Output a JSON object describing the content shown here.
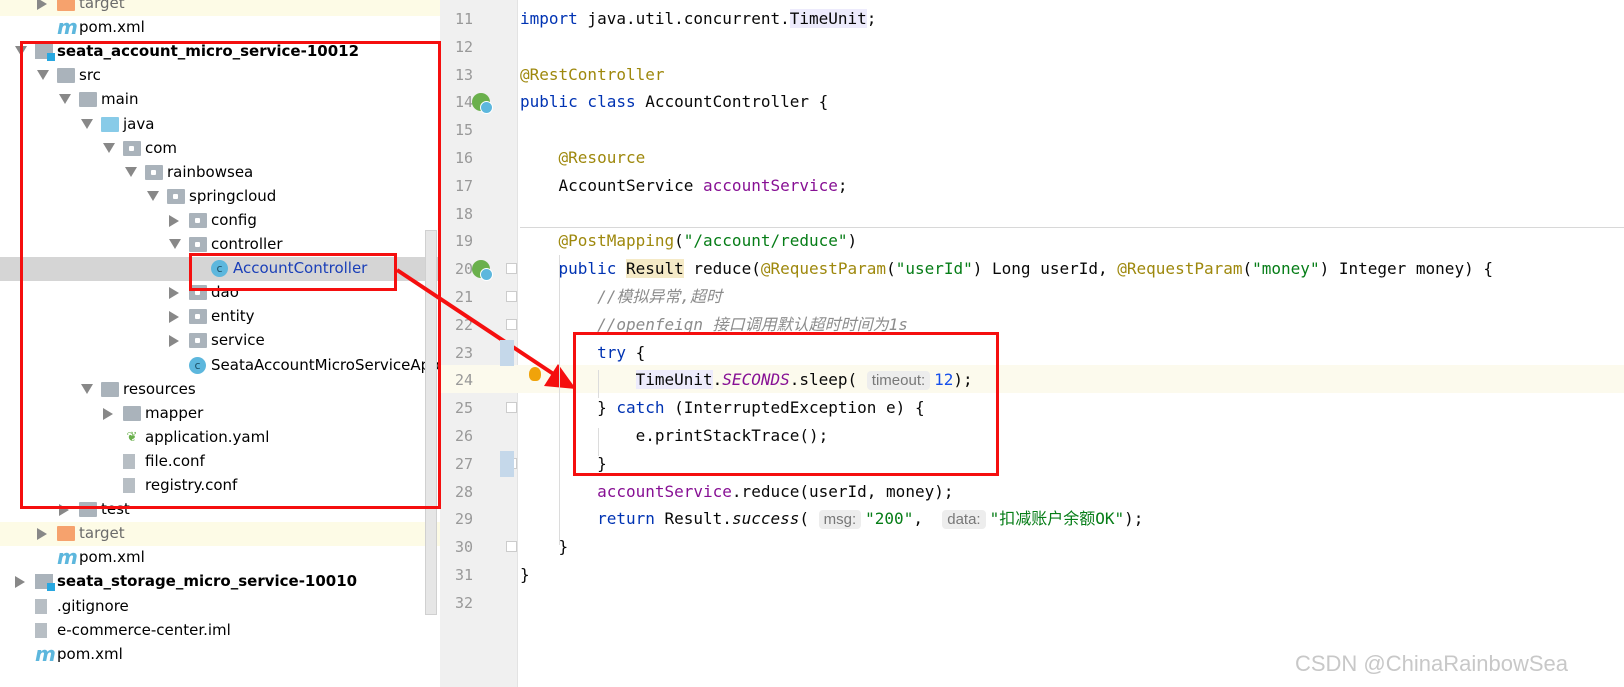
{
  "project_tree": [
    {
      "label": "target",
      "level": 1,
      "arrow": "closed",
      "icon": "folder-target",
      "style": "orange",
      "excluded": true
    },
    {
      "label": "pom.xml",
      "level": 1,
      "arrow": "none",
      "icon": "maven"
    },
    {
      "label": "seata_account_micro_service-10012",
      "level": 0,
      "arrow": "open",
      "icon": "module",
      "style": "bold"
    },
    {
      "label": "src",
      "level": 1,
      "arrow": "open",
      "icon": "folder"
    },
    {
      "label": "main",
      "level": 2,
      "arrow": "open",
      "icon": "folder"
    },
    {
      "label": "java",
      "level": 3,
      "arrow": "open",
      "icon": "folder-src"
    },
    {
      "label": "com",
      "level": 4,
      "arrow": "open",
      "icon": "package"
    },
    {
      "label": "rainbowsea",
      "level": 5,
      "arrow": "open",
      "icon": "package"
    },
    {
      "label": "springcloud",
      "level": 6,
      "arrow": "open",
      "icon": "package"
    },
    {
      "label": "config",
      "level": 7,
      "arrow": "closed",
      "icon": "package"
    },
    {
      "label": "controller",
      "level": 7,
      "arrow": "open",
      "icon": "package"
    },
    {
      "label": "AccountController",
      "level": 8,
      "arrow": "none",
      "icon": "class",
      "style": "blue",
      "selected": true
    },
    {
      "label": "dao",
      "level": 7,
      "arrow": "closed",
      "icon": "package"
    },
    {
      "label": "entity",
      "level": 7,
      "arrow": "closed",
      "icon": "package"
    },
    {
      "label": "service",
      "level": 7,
      "arrow": "closed",
      "icon": "package"
    },
    {
      "label": "SeataAccountMicroServiceApplication",
      "level": 7,
      "arrow": "none",
      "icon": "class"
    },
    {
      "label": "resources",
      "level": 3,
      "arrow": "open",
      "icon": "folder"
    },
    {
      "label": "mapper",
      "level": 4,
      "arrow": "closed",
      "icon": "folder"
    },
    {
      "label": "application.yaml",
      "level": 4,
      "arrow": "none",
      "icon": "yaml"
    },
    {
      "label": "file.conf",
      "level": 4,
      "arrow": "none",
      "icon": "file"
    },
    {
      "label": "registry.conf",
      "level": 4,
      "arrow": "none",
      "icon": "file"
    },
    {
      "label": "test",
      "level": 2,
      "arrow": "closed",
      "icon": "folder"
    },
    {
      "label": "target",
      "level": 1,
      "arrow": "closed",
      "icon": "folder-target",
      "style": "orange",
      "excluded": true
    },
    {
      "label": "pom.xml",
      "level": 1,
      "arrow": "none",
      "icon": "maven"
    },
    {
      "label": "seata_storage_micro_service-10010",
      "level": 0,
      "arrow": "closed",
      "icon": "module",
      "style": "bold"
    },
    {
      "label": ".gitignore",
      "level": 0,
      "arrow": "none",
      "icon": "file"
    },
    {
      "label": "e-commerce-center.iml",
      "level": 0,
      "arrow": "none",
      "icon": "file"
    },
    {
      "label": "pom.xml",
      "level": 0,
      "arrow": "none",
      "icon": "maven"
    }
  ],
  "editor": {
    "lines": [
      {
        "n": "11",
        "tokens": [
          [
            "import",
            "kw"
          ],
          [
            " java.util.concurrent.",
            ""
          ],
          [
            "TimeUnit",
            "hl"
          ],
          [
            ";",
            ""
          ]
        ]
      },
      {
        "n": "12",
        "tokens": []
      },
      {
        "n": "13",
        "tokens": [
          [
            "@RestController",
            "an"
          ]
        ]
      },
      {
        "n": "14",
        "tokens": [
          [
            "public class ",
            "kw"
          ],
          [
            "AccountController {",
            ""
          ]
        ]
      },
      {
        "n": "15",
        "tokens": []
      },
      {
        "n": "16",
        "tokens": [
          [
            "    ",
            ""
          ],
          [
            "@Resource",
            "an"
          ]
        ]
      },
      {
        "n": "17",
        "tokens": [
          [
            "    AccountService ",
            ""
          ],
          [
            "accountService",
            "fd"
          ],
          [
            ";",
            ""
          ]
        ]
      },
      {
        "n": "18",
        "tokens": []
      },
      {
        "n": "19",
        "tokens": [
          [
            "    ",
            ""
          ],
          [
            "@PostMapping",
            "an"
          ],
          [
            "(",
            ""
          ],
          [
            "\"/account/reduce\"",
            "st"
          ],
          [
            ")",
            ""
          ]
        ]
      },
      {
        "n": "20",
        "tokens": [
          [
            "    ",
            ""
          ],
          [
            "public ",
            "kw"
          ],
          [
            "Result",
            "hly"
          ],
          [
            " reduce(",
            ""
          ],
          [
            "@RequestParam",
            "an"
          ],
          [
            "(",
            ""
          ],
          [
            "\"userId\"",
            "st"
          ],
          [
            ") Long userId, ",
            ""
          ],
          [
            "@RequestParam",
            "an"
          ],
          [
            "(",
            ""
          ],
          [
            "\"money\"",
            "st"
          ],
          [
            ") Integer money) {",
            ""
          ]
        ]
      },
      {
        "n": "21",
        "tokens": [
          [
            "        ",
            ""
          ],
          [
            "//模拟异常,超时",
            "cm"
          ]
        ]
      },
      {
        "n": "22",
        "tokens": [
          [
            "        ",
            ""
          ],
          [
            "//openfeign 接口调用默认超时时间为1s",
            "cm"
          ]
        ]
      },
      {
        "n": "23",
        "tokens": [
          [
            "        ",
            ""
          ],
          [
            "try ",
            "kw"
          ],
          [
            "{",
            ""
          ]
        ]
      },
      {
        "n": "24",
        "tokens": [
          [
            "            ",
            ""
          ],
          [
            "TimeUnit",
            "hl"
          ],
          [
            ".",
            ""
          ],
          [
            "SECONDS",
            "sf"
          ],
          [
            ".sleep( ",
            ""
          ],
          [
            "timeout:",
            "hint"
          ],
          [
            "12",
            "nm"
          ],
          [
            ");",
            ""
          ]
        ]
      },
      {
        "n": "25",
        "tokens": [
          [
            "        } ",
            ""
          ],
          [
            "catch ",
            "kw"
          ],
          [
            "(InterruptedException e) {",
            ""
          ]
        ]
      },
      {
        "n": "26",
        "tokens": [
          [
            "            e.printStackTrace();",
            ""
          ]
        ]
      },
      {
        "n": "27",
        "tokens": [
          [
            "        }",
            ""
          ]
        ]
      },
      {
        "n": "28",
        "tokens": [
          [
            "        ",
            ""
          ],
          [
            "accountService",
            "fd"
          ],
          [
            ".reduce(userId, money);",
            ""
          ]
        ]
      },
      {
        "n": "29",
        "tokens": [
          [
            "        ",
            ""
          ],
          [
            "return ",
            "kw"
          ],
          [
            "Result.",
            ""
          ],
          [
            "success",
            "it"
          ],
          [
            "( ",
            ""
          ],
          [
            "msg:",
            "hint"
          ],
          [
            "\"200\"",
            "st"
          ],
          [
            ",  ",
            ""
          ],
          [
            "data:",
            "hint"
          ],
          [
            "\"扣减账户余额OK\"",
            "st"
          ],
          [
            ");",
            ""
          ]
        ]
      },
      {
        "n": "30",
        "tokens": [
          [
            "    }",
            ""
          ]
        ]
      },
      {
        "n": "31",
        "tokens": [
          [
            "}",
            ""
          ]
        ]
      },
      {
        "n": "32",
        "tokens": []
      }
    ]
  },
  "watermark": "CSDN @ChinaRainbowSea"
}
